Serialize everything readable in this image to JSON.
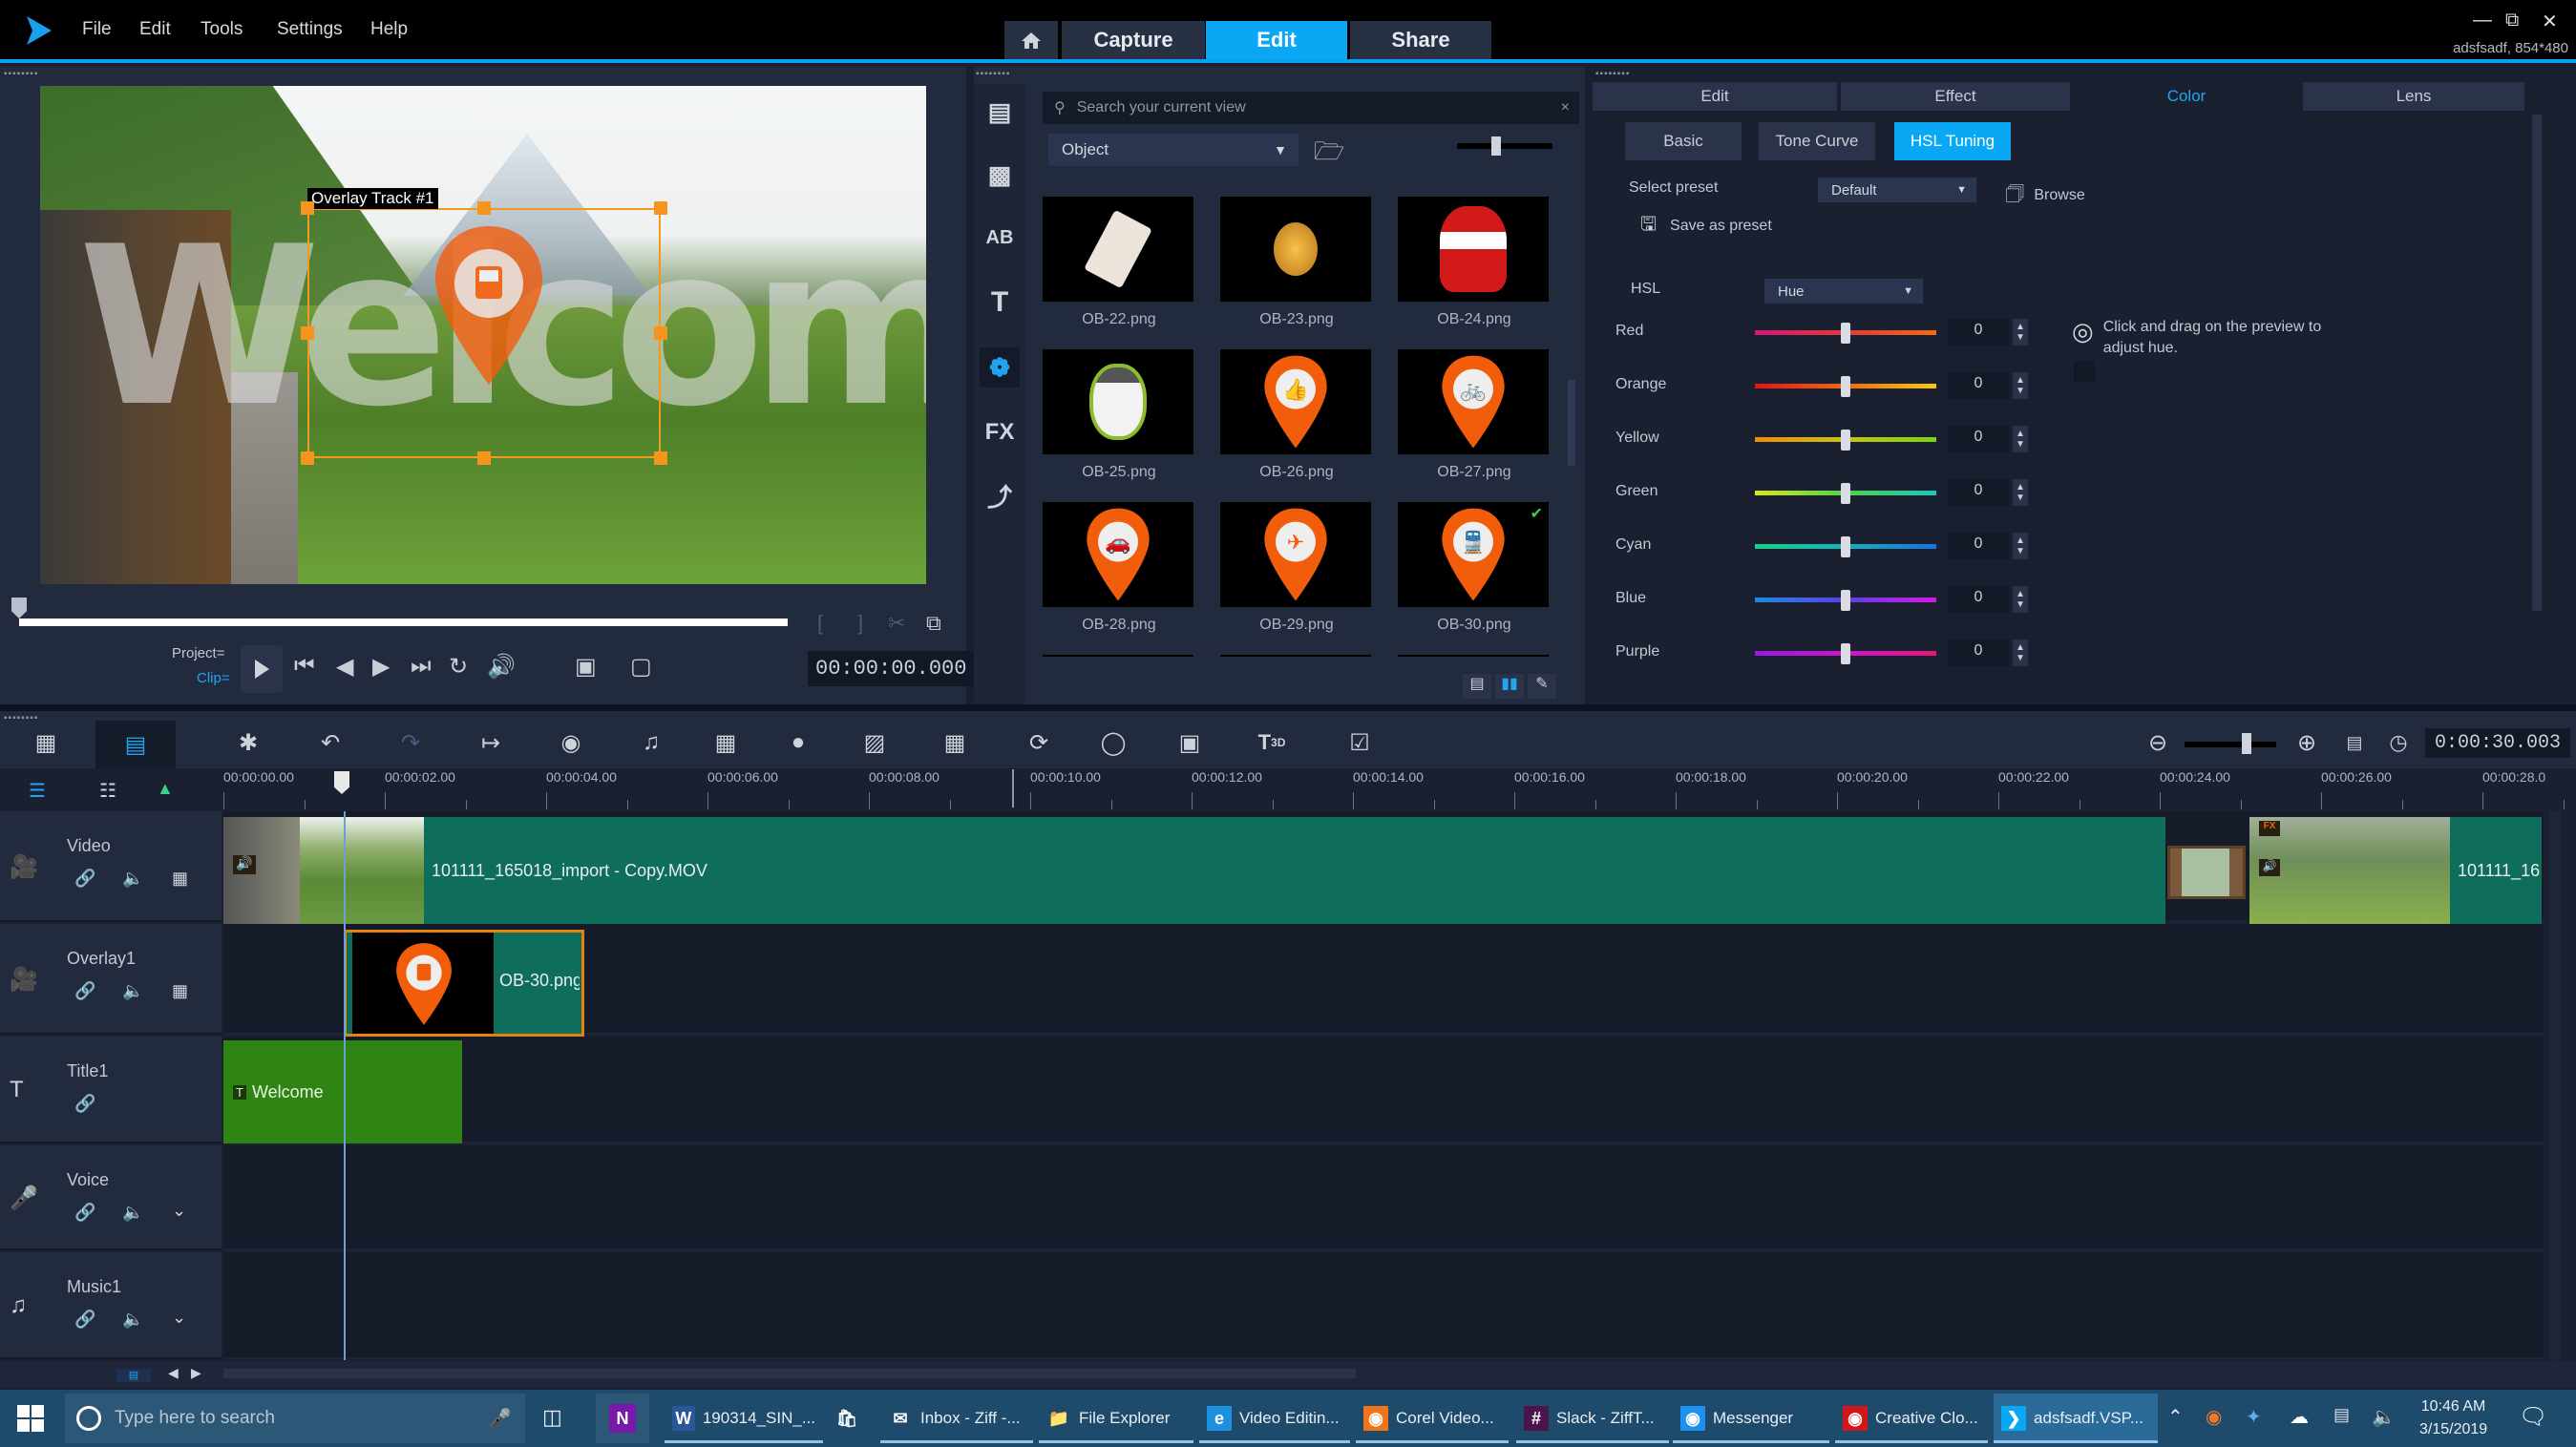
{
  "app": {
    "menu": [
      "File",
      "Edit",
      "Tools",
      "Settings",
      "Help"
    ],
    "mode_tabs": [
      {
        "label": "Capture",
        "active": false
      },
      {
        "label": "Edit",
        "active": true
      },
      {
        "label": "Share",
        "active": false
      }
    ],
    "project_info": "adsfsadf, 854*480",
    "accent": "#0aa7f5"
  },
  "preview": {
    "overlay_label": "Overlay Track #1",
    "title_text": "Welcome",
    "project_label": "Project",
    "clip_label": "Clip",
    "timecode": "00:00:00.000"
  },
  "library": {
    "search_placeholder": "Search your current view",
    "category": "Object",
    "items": [
      {
        "name": "OB-22.png",
        "kind": "tag"
      },
      {
        "name": "OB-23.png",
        "kind": "ornament"
      },
      {
        "name": "OB-24.png",
        "kind": "santa"
      },
      {
        "name": "OB-25.png",
        "kind": "snowman"
      },
      {
        "name": "OB-26.png",
        "kind": "pin-thumbs-up"
      },
      {
        "name": "OB-27.png",
        "kind": "pin-bicycle"
      },
      {
        "name": "OB-28.png",
        "kind": "pin-car"
      },
      {
        "name": "OB-29.png",
        "kind": "pin-plane"
      },
      {
        "name": "OB-30.png",
        "kind": "pin-train",
        "checked": true
      }
    ],
    "side_icons": [
      "media",
      "instant-project",
      "transition",
      "title",
      "graphics",
      "filter",
      "motion-path"
    ]
  },
  "options": {
    "tabs": [
      {
        "label": "Edit"
      },
      {
        "label": "Effect"
      },
      {
        "label": "Color",
        "active": true
      },
      {
        "label": "Lens"
      }
    ],
    "subtabs": [
      {
        "label": "Basic"
      },
      {
        "label": "Tone Curve"
      },
      {
        "label": "HSL Tuning",
        "active": true
      }
    ],
    "select_preset_label": "Select preset",
    "preset_value": "Default",
    "browse_label": "Browse",
    "save_preset_label": "Save as preset",
    "hsl_label": "HSL",
    "hsl_mode": "Hue",
    "hint": "Click and drag on the preview to adjust hue.",
    "sliders": [
      {
        "name": "Red",
        "value": "0",
        "gradient": [
          "#d6157a",
          "#e23a3a",
          "#f26a10"
        ]
      },
      {
        "name": "Orange",
        "value": "0",
        "gradient": [
          "#e0141c",
          "#f06a10",
          "#f5c812"
        ]
      },
      {
        "name": "Yellow",
        "value": "0",
        "gradient": [
          "#f08a10",
          "#c8c018",
          "#7ad21a"
        ]
      },
      {
        "name": "Green",
        "value": "0",
        "gradient": [
          "#d8e81a",
          "#4fd24a",
          "#18c8b8"
        ]
      },
      {
        "name": "Cyan",
        "value": "0",
        "gradient": [
          "#18d088",
          "#18b0b8",
          "#1870e0"
        ]
      },
      {
        "name": "Blue",
        "value": "0",
        "gradient": [
          "#1a8ae8",
          "#5a40e8",
          "#d818e8"
        ]
      },
      {
        "name": "Purple",
        "value": "0",
        "gradient": [
          "#9a18e0",
          "#c818c8",
          "#e81878"
        ]
      }
    ]
  },
  "timeline": {
    "total_duration": "0:00:30.003",
    "ruler_ticks": [
      "00:00:00.00",
      "00:00:02.00",
      "00:00:04.00",
      "00:00:06.00",
      "00:00:08.00",
      "00:00:10.00",
      "00:00:12.00",
      "00:00:14.00",
      "00:00:16.00",
      "00:00:18.00",
      "00:00:20.00",
      "00:00:22.00",
      "00:00:24.00",
      "00:00:26.00",
      "00:00:28.0"
    ],
    "tracks": [
      {
        "name": "Video",
        "type": "video"
      },
      {
        "name": "Overlay1",
        "type": "overlay"
      },
      {
        "name": "Title1",
        "type": "title"
      },
      {
        "name": "Voice",
        "type": "voice"
      },
      {
        "name": "Music1",
        "type": "music"
      }
    ],
    "clips": {
      "video_main": "101111_165018_import - Copy.MOV",
      "video_second": "101111_16",
      "overlay": "OB-30.png",
      "title": "Welcome"
    }
  },
  "taskbar": {
    "search_placeholder": "Type here to search",
    "items": [
      {
        "label": "190314_SIN_...",
        "icon": "W",
        "color": "#2b579a"
      },
      {
        "label": "",
        "icon": "store",
        "color": "#fff"
      },
      {
        "label": "Inbox - Ziff -...",
        "icon": "mail",
        "color": "#fff"
      },
      {
        "label": "File Explorer",
        "icon": "folder",
        "color": "#f3c14b"
      },
      {
        "label": "Video Editin...",
        "icon": "e",
        "color": "#1e90e0"
      },
      {
        "label": "Corel Video...",
        "icon": "firefox",
        "color": "#f0751a"
      },
      {
        "label": "Slack - ZiffT...",
        "icon": "slack",
        "color": "#4a154b"
      },
      {
        "label": "Messenger",
        "icon": "messenger",
        "color": "#1e90f0"
      },
      {
        "label": "Creative Clo...",
        "icon": "cc",
        "color": "#d3161a"
      },
      {
        "label": "adsfsadf.VSP...",
        "icon": "vs",
        "color": "#0aa7f5",
        "active": true
      }
    ],
    "time": "10:46 AM",
    "date": "3/15/2019"
  }
}
